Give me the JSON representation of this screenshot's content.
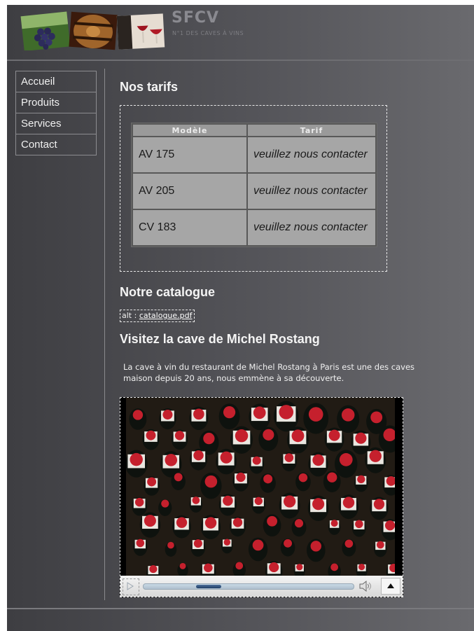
{
  "header": {
    "title": "SFCV",
    "tagline": "N°1 DES CAVES À VINS"
  },
  "nav": {
    "items": [
      {
        "label": "Accueil"
      },
      {
        "label": "Produits"
      },
      {
        "label": "Services"
      },
      {
        "label": "Contact"
      }
    ]
  },
  "tarifs": {
    "title": "Nos tarifs",
    "headers": [
      "Modèle",
      "Tarif"
    ],
    "rows": [
      {
        "model": "AV 175",
        "price": "veuillez nous contacter"
      },
      {
        "model": "AV 205",
        "price": "veuillez nous contacter"
      },
      {
        "model": "CV 183",
        "price": "veuillez nous contacter"
      }
    ]
  },
  "catalogue": {
    "title": "Notre catalogue",
    "alt_prefix": "alt :",
    "link": "catalogue.pdf"
  },
  "cave": {
    "title": "Visitez la cave de Michel Rostang",
    "desc_line1": "La cave à vin du restaurant de Michel Rostang à Paris est une des caves",
    "desc_line2": "maison depuis 20 ans, nous emmène à sa découverte."
  },
  "video": {
    "progress": 0.12,
    "buffered": 0.12
  },
  "colors": {
    "accent": "#1f3e66",
    "bottle_cap": "#c5202d"
  }
}
